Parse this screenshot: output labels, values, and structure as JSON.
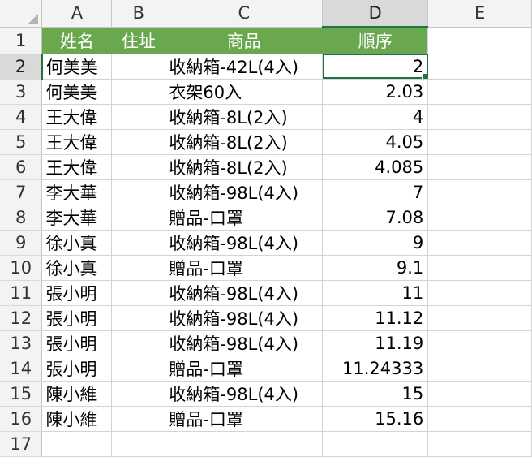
{
  "columns": [
    "A",
    "B",
    "C",
    "D",
    "E"
  ],
  "header_row": {
    "row": "1",
    "A": "姓名",
    "B": "住址",
    "C": "商品",
    "D": "順序",
    "E": ""
  },
  "rows": [
    {
      "row": "2",
      "A": "何美美",
      "B": "",
      "C": "收納箱-42L(4入)",
      "D": "2"
    },
    {
      "row": "3",
      "A": "何美美",
      "B": "",
      "C": "衣架60入",
      "D": "2.03"
    },
    {
      "row": "4",
      "A": "王大偉",
      "B": "",
      "C": "收納箱-8L(2入)",
      "D": "4"
    },
    {
      "row": "5",
      "A": "王大偉",
      "B": "",
      "C": "收納箱-8L(2入)",
      "D": "4.05"
    },
    {
      "row": "6",
      "A": "王大偉",
      "B": "",
      "C": "收納箱-8L(2入)",
      "D": "4.085"
    },
    {
      "row": "7",
      "A": "李大華",
      "B": "",
      "C": "收納箱-98L(4入)",
      "D": "7"
    },
    {
      "row": "8",
      "A": "李大華",
      "B": "",
      "C": "贈品-口罩",
      "D": "7.08"
    },
    {
      "row": "9",
      "A": "徐小真",
      "B": "",
      "C": "收納箱-98L(4入)",
      "D": "9"
    },
    {
      "row": "10",
      "A": "徐小真",
      "B": "",
      "C": "贈品-口罩",
      "D": "9.1"
    },
    {
      "row": "11",
      "A": "張小明",
      "B": "",
      "C": "收納箱-98L(4入)",
      "D": "11"
    },
    {
      "row": "12",
      "A": "張小明",
      "B": "",
      "C": "收納箱-98L(4入)",
      "D": "11.12"
    },
    {
      "row": "13",
      "A": "張小明",
      "B": "",
      "C": "收納箱-98L(4入)",
      "D": "11.19"
    },
    {
      "row": "14",
      "A": "張小明",
      "B": "",
      "C": "贈品-口罩",
      "D": "11.24333"
    },
    {
      "row": "15",
      "A": "陳小維",
      "B": "",
      "C": "收納箱-98L(4入)",
      "D": "15"
    },
    {
      "row": "16",
      "A": "陳小維",
      "B": "",
      "C": "贈品-口罩",
      "D": "15.16"
    },
    {
      "row": "17",
      "A": "",
      "B": "",
      "C": "",
      "D": ""
    }
  ],
  "active_cell": "D2",
  "colors": {
    "header_fill": "#6aa84f",
    "selection": "#217346"
  }
}
